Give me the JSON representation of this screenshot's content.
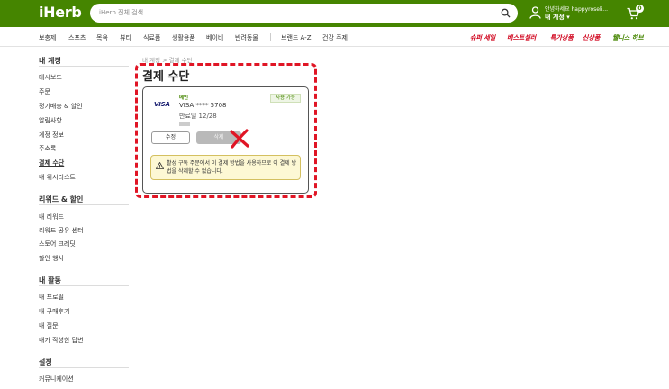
{
  "header": {
    "logo": "iHerb",
    "search_placeholder": "iHerb 전체 검색",
    "greeting": "안녕하세요 happyroseli...",
    "my_account": "내 계정 ▾",
    "cart_count": "0",
    "brand_color": "#458500"
  },
  "nav": {
    "items": [
      "보충제",
      "스포츠",
      "목욕",
      "뷰티",
      "식료품",
      "생활용품",
      "베이비",
      "반려동물"
    ],
    "brands": "브랜드 A-Z",
    "health": "건강 주제",
    "promo": [
      "슈퍼 세일",
      "베스트셀러",
      "특가상품",
      "신상품"
    ],
    "wellness": "웰니스 허브"
  },
  "sidebar": {
    "sections": [
      {
        "title": "내 계정",
        "items": [
          "대시보드",
          "주문",
          "정기배송 & 할인",
          "알림사항",
          "계정 정보",
          "주소록",
          "결제 수단",
          "내 위시리스트"
        ]
      },
      {
        "title": "리워드 & 할인",
        "items": [
          "내 리워드",
          "리워드 공유 센터",
          "스토어 크레딧",
          "할인 행사"
        ]
      },
      {
        "title": "내 활동",
        "items": [
          "내 프로필",
          "내 구매후기",
          "내 질문",
          "내가 작성한 답변"
        ]
      },
      {
        "title": "설정",
        "items": [
          "커뮤니케이션"
        ]
      }
    ],
    "active": "결제 수단"
  },
  "main": {
    "breadcrumb": "내 계정 > 결제 수단",
    "title": "결제 수단",
    "card": {
      "brand": "VISA",
      "label": "메인",
      "number": "VISA **** 5708",
      "expiry": "만료일 12/28",
      "status": "사용 가능",
      "edit_label": "수정",
      "delete_label": "삭제"
    },
    "warning": "활성 구독 주문에서 이 결제 방법을 사용하므로 이 결제 방법을 삭제할 수 없습니다."
  }
}
